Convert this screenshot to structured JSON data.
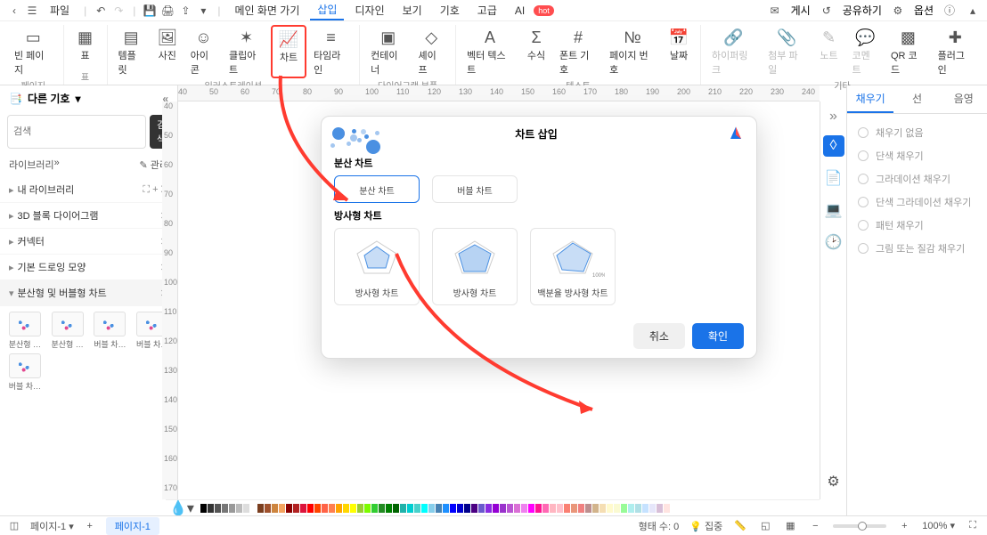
{
  "menubar": {
    "file": "파일",
    "main_page": "메인 화면 가기",
    "tabs": [
      "삽입",
      "디자인",
      "보기",
      "기호",
      "고급",
      "AI"
    ],
    "ai_badge": "hot",
    "publish": "게시",
    "share": "공유하기",
    "options": "옵션"
  },
  "ribbon": {
    "groups": [
      {
        "label": "페이지",
        "items": [
          {
            "label": "빈 페이지"
          }
        ]
      },
      {
        "label": "표",
        "items": [
          {
            "label": "표"
          }
        ]
      },
      {
        "label": "일러스트레이션",
        "items": [
          {
            "label": "템플릿"
          },
          {
            "label": "사진"
          },
          {
            "label": "아이콘"
          },
          {
            "label": "클립아트"
          },
          {
            "label": "차트",
            "highlight": true
          },
          {
            "label": "타임라인"
          }
        ]
      },
      {
        "label": "다이어그램 부품",
        "items": [
          {
            "label": "컨테이너"
          },
          {
            "label": "셰이프"
          }
        ]
      },
      {
        "label": "텍스트",
        "items": [
          {
            "label": "벡터 텍스트"
          },
          {
            "label": "수식"
          },
          {
            "label": "폰트 기호"
          },
          {
            "label": "페이지 번호"
          },
          {
            "label": "날짜"
          }
        ]
      },
      {
        "label": "기타",
        "items": [
          {
            "label": "하이퍼링크",
            "disabled": true
          },
          {
            "label": "첨부 파일",
            "disabled": true
          },
          {
            "label": "노트",
            "disabled": true
          },
          {
            "label": "코멘트",
            "disabled": true
          },
          {
            "label": "QR 코드"
          },
          {
            "label": "플러그인"
          }
        ]
      }
    ]
  },
  "ruler": {
    "ticks": [
      "40",
      "50",
      "60",
      "70",
      "80",
      "90",
      "100",
      "110",
      "120",
      "130",
      "140",
      "150",
      "160",
      "170",
      "180",
      "190",
      "200",
      "210",
      "220",
      "230",
      "240"
    ],
    "vticks": [
      "40",
      "50",
      "60",
      "70",
      "80",
      "90",
      "100",
      "110",
      "120",
      "130",
      "140",
      "150",
      "160",
      "170"
    ]
  },
  "left": {
    "header": "다른 기호",
    "search_placeholder": "검색",
    "search_btn": "검색",
    "library": "라이브러리",
    "manage": "관리",
    "items": [
      {
        "label": "내 라이브러리"
      },
      {
        "label": "3D 블록 다이어그램"
      },
      {
        "label": "커넥터"
      },
      {
        "label": "기본 드로잉 모양"
      },
      {
        "label": "분산형 및 버블형 차트",
        "expanded": true
      }
    ],
    "shapes": [
      "분산형 …",
      "분산형 …",
      "버블 차…",
      "버블 차…",
      "버블 차…"
    ]
  },
  "right": {
    "tabs": [
      "채우기",
      "선",
      "음영"
    ],
    "options": [
      "채우기 없음",
      "단색 채우기",
      "그라데이션 채우기",
      "단색 그라데이션 채우기",
      "패턴 채우기",
      "그림 또는 질감 채우기"
    ]
  },
  "modal": {
    "title": "차트 삽입",
    "section1": "분산 차트",
    "section2": "방사형 차트",
    "cards1": [
      "분산 차트",
      "버블 차트"
    ],
    "cards2": [
      "방사형 차트",
      "방사형 차트",
      "백분율 방사형 차트"
    ],
    "cancel": "취소",
    "ok": "확인",
    "percent_label": "100%"
  },
  "status": {
    "page_select": "페이지-1",
    "page_tab": "페이지-1",
    "shape_count": "형태 수: 0",
    "focus": "집중",
    "zoom": "100%"
  },
  "palette_colors": [
    "#000000",
    "#333333",
    "#555555",
    "#777777",
    "#999999",
    "#bbbbbb",
    "#dddddd",
    "#ffffff",
    "#7a3e1f",
    "#a0522d",
    "#cd853f",
    "#f4a460",
    "#8b0000",
    "#b22222",
    "#dc143c",
    "#ff0000",
    "#ff4500",
    "#ff6347",
    "#ff7f50",
    "#ffa500",
    "#ffd700",
    "#ffff00",
    "#9acd32",
    "#7cfc00",
    "#32cd32",
    "#228b22",
    "#008000",
    "#006400",
    "#20b2aa",
    "#00ced1",
    "#48d1cc",
    "#00ffff",
    "#87ceeb",
    "#4682b4",
    "#1e90ff",
    "#0000ff",
    "#0000cd",
    "#00008b",
    "#4b0082",
    "#6a5acd",
    "#8a2be2",
    "#9400d3",
    "#9932cc",
    "#ba55d3",
    "#da70d6",
    "#ee82ee",
    "#ff00ff",
    "#ff1493",
    "#ff69b4",
    "#ffb6c1",
    "#ffc0cb",
    "#fa8072",
    "#e9967a",
    "#f08080",
    "#bc8f8f",
    "#d2b48c",
    "#f5deb3",
    "#fffacd",
    "#fafad2",
    "#98fb98",
    "#afeeee",
    "#b0e0e6",
    "#c6e2ff",
    "#e6e6fa",
    "#d8bfd8",
    "#ffe4e1"
  ]
}
